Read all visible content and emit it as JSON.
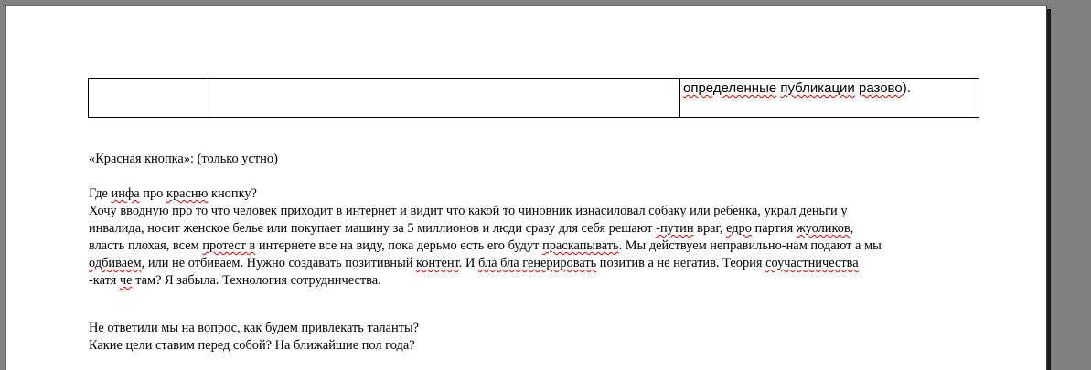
{
  "table": {
    "row1": {
      "cell1": "",
      "cell2": "",
      "cell3_parts": [
        "определенные",
        " ",
        "публикации",
        " ",
        "разово",
        ")."
      ]
    }
  },
  "section_heading": "«Красная кнопка»: (только устно)",
  "paragraph1": {
    "line1": [
      "Где ",
      "инфа",
      " про ",
      "красню",
      " кнопку?"
    ],
    "line2": [
      "Хочу вводную про то что человек приходит в интернет и видит что какой то чиновник изнасиловал собаку или ребенка, украл деньги у"
    ],
    "line3": [
      "инвалида, носит женское белье или покупает машину за 5 миллионов и люди сразу для себя решают  ",
      "-путин",
      " враг, ",
      "едро",
      " партия ",
      "жуоликов",
      ","
    ],
    "line4": [
      "власть плохая, всем ",
      "протест в",
      " интернете все на виду, пока дерьмо есть его будут ",
      "праскапывать",
      ". Мы действуем неправильно-нам подают а мы"
    ],
    "line5": [
      "",
      "одбиваем",
      ", или не отбиваем. Нужно создавать позитивный ",
      "контент",
      ". И ",
      "бла бла генерировать",
      " позитив а не негатив. Теория ",
      "соучастничества"
    ],
    "line6": [
      "-катя ",
      "че",
      " там? Я забыла. Технология сотрудничества."
    ]
  },
  "paragraph2": {
    "line1": "Не ответили мы на вопрос, как будем привлекать таланты?",
    "line2": "Какие цели ставим перед собой? На ближайшие пол года?"
  }
}
